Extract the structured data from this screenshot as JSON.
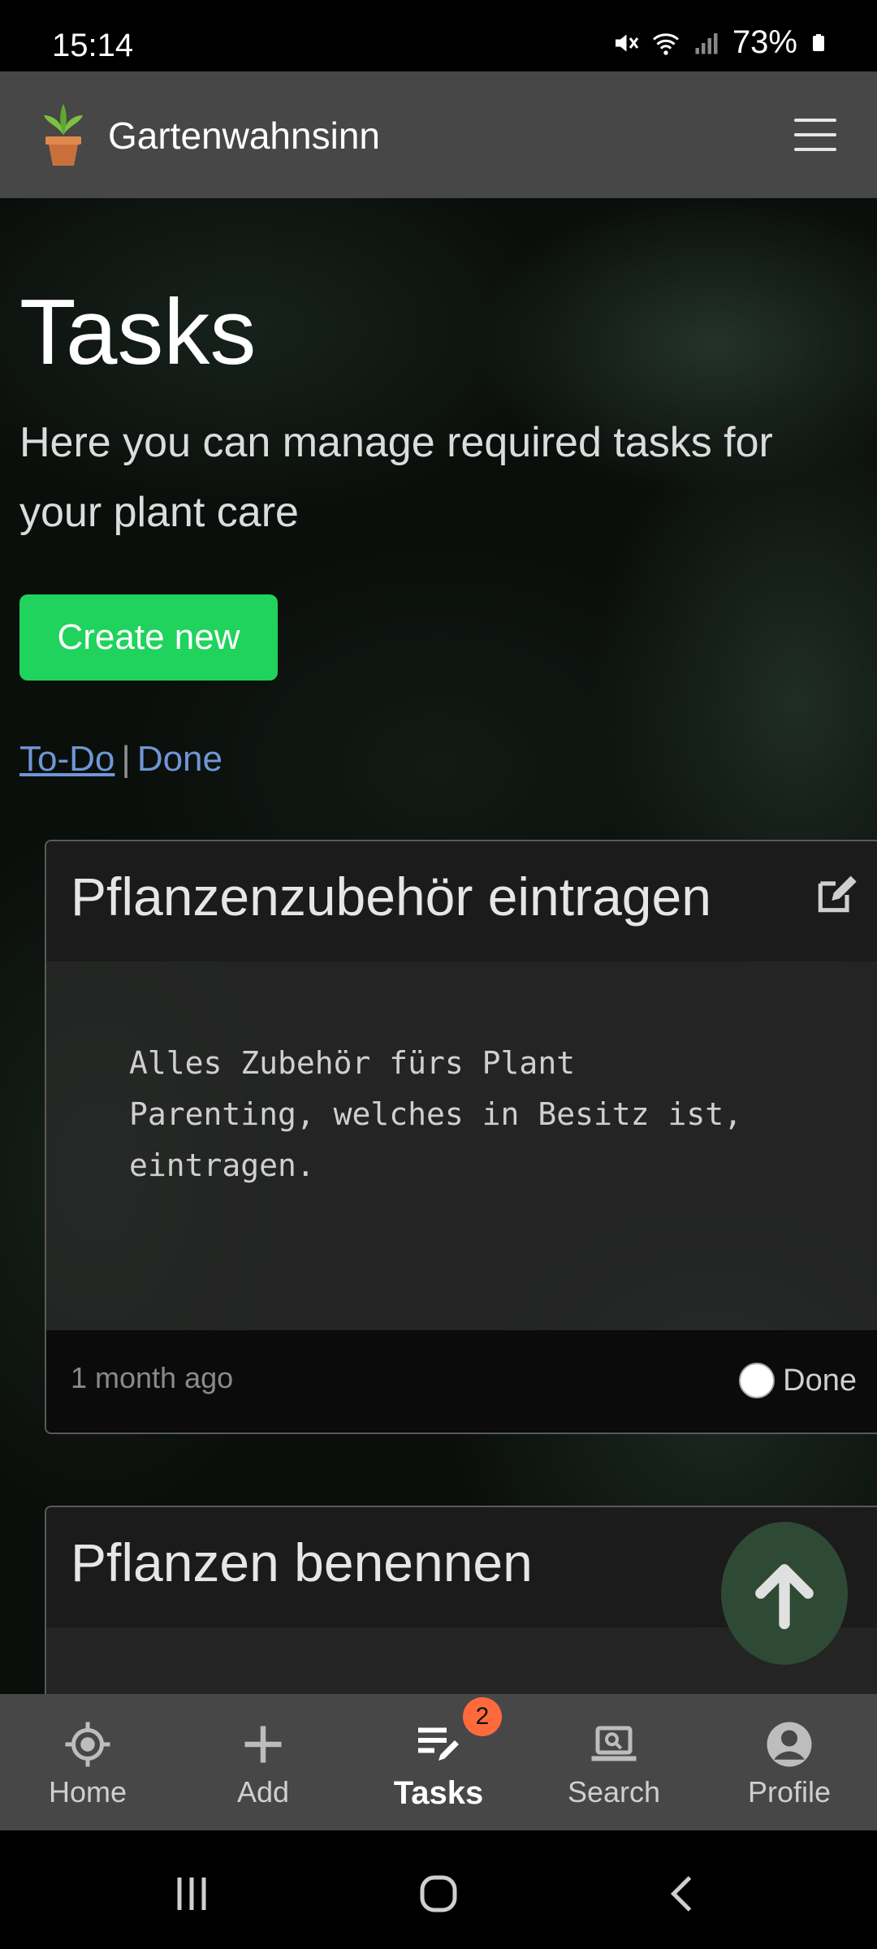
{
  "status_bar": {
    "time": "15:14",
    "battery": "73%"
  },
  "app_bar": {
    "title": "Gartenwahnsinn"
  },
  "page": {
    "title": "Tasks",
    "lead": "Here you can manage required tasks for your plant care",
    "create_label": "Create new",
    "filter": {
      "todo": "To-Do",
      "separator": "|",
      "done": "Done"
    }
  },
  "tasks": [
    {
      "title": "Pflanzenzubehör eintragen",
      "body": "Alles Zubehör fürs Plant Parenting, welches in Besitz ist, eintragen.",
      "time": "1 month ago",
      "done_label": "Done"
    },
    {
      "title": "Pflanzen benennen"
    }
  ],
  "bottom_nav": {
    "items": [
      {
        "label": "Home",
        "icon": "crosshair-icon"
      },
      {
        "label": "Add",
        "icon": "plus-icon"
      },
      {
        "label": "Tasks",
        "icon": "tasks-pen-icon",
        "badge": "2",
        "active": true
      },
      {
        "label": "Search",
        "icon": "laptop-search-icon"
      },
      {
        "label": "Profile",
        "icon": "user-circle-icon"
      }
    ]
  },
  "colors": {
    "accent_green": "#1fd35c",
    "link_blue": "#6f96d6",
    "badge": "#ff6a3c",
    "bar": "#474747"
  }
}
